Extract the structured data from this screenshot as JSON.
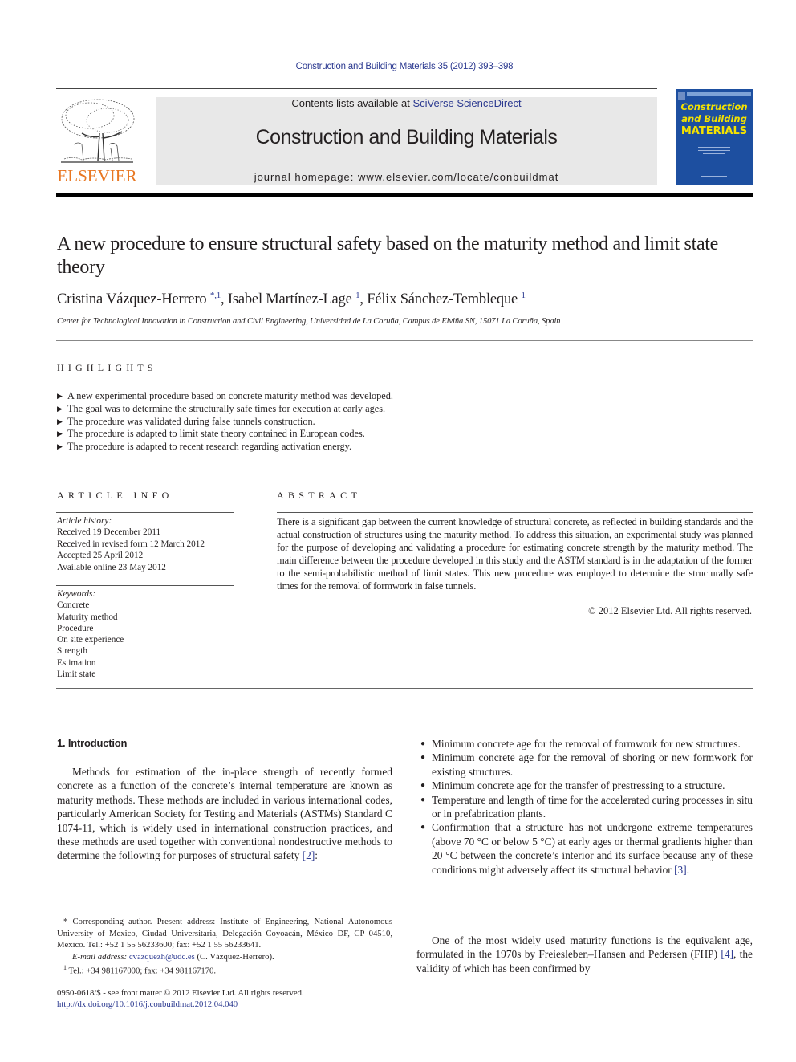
{
  "journal_ref": "Construction and Building Materials 35 (2012) 393–398",
  "header": {
    "publisher_logo_text": "ELSEVIER",
    "contents_prefix": "Contents lists available at ",
    "contents_link": "SciVerse ScienceDirect",
    "journal_title": "Construction and Building Materials",
    "homepage": "journal homepage: www.elsevier.com/locate/conbuildmat",
    "cover": {
      "line1": "Construction",
      "line2": "and Building",
      "line3": "MATERIALS",
      "bg_color": "#1d4fa0",
      "title_color": "#f4e200"
    }
  },
  "article": {
    "title": "A new procedure to ensure structural safety based on the maturity method and limit state theory",
    "authors": [
      {
        "name": "Cristina Vázquez-Herrero",
        "marks": "*,1"
      },
      {
        "name": "Isabel Martínez-Lage",
        "marks": "1"
      },
      {
        "name": "Félix Sánchez-Tembleque",
        "marks": "1"
      }
    ],
    "affiliation": "Center for Technological Innovation in Construction and Civil Engineering, Universidad de La Coruña, Campus de Elviña SN, 15071 La Coruña, Spain"
  },
  "highlights": {
    "label": "HIGHLIGHTS",
    "items": [
      "A new experimental procedure based on concrete maturity method was developed.",
      "The goal was to determine the structurally safe times for execution at early ages.",
      "The procedure was validated during false tunnels construction.",
      "The procedure is adapted to limit state theory contained in European codes.",
      "The procedure is adapted to recent research regarding activation energy."
    ]
  },
  "article_info": {
    "label": "ARTICLE INFO",
    "history_label": "Article history:",
    "history": [
      "Received 19 December 2011",
      "Received in revised form 12 March 2012",
      "Accepted 25 April 2012",
      "Available online 23 May 2012"
    ],
    "keywords_label": "Keywords:",
    "keywords": [
      "Concrete",
      "Maturity method",
      "Procedure",
      "On site experience",
      "Strength",
      "Estimation",
      "Limit state"
    ]
  },
  "abstract": {
    "label": "ABSTRACT",
    "text": "There is a significant gap between the current knowledge of structural concrete, as reflected in building standards and the actual construction of structures using the maturity method. To address this situation, an experimental study was planned for the purpose of developing and validating a procedure for estimating concrete strength by the maturity method. The main difference between the procedure developed in this study and the ASTM standard is in the adaptation of the former to the semi-probabilistic method of limit states. This new procedure was employed to determine the structurally safe times for the removal of formwork in false tunnels.",
    "copyright": "© 2012 Elsevier Ltd. All rights reserved."
  },
  "introduction": {
    "heading": "1. Introduction",
    "p1_text": "Methods for estimation of the in-place strength of recently formed concrete as a function of the concrete’s internal temperature are known as maturity methods. These methods are included in various international codes, particularly American Society for Testing and Materials (ASTMs) Standard C 1074-11, which is widely used in international construction practices, and these methods are used together with conventional nondestructive methods to determine the following for purposes of structural safety ",
    "p1_ref": "[2]",
    "p1_end": ":",
    "bullets": [
      {
        "text": "Minimum concrete age for the removal of formwork for new structures.",
        "ref": ""
      },
      {
        "text": "Minimum concrete age for the removal of shoring or new formwork for existing structures.",
        "ref": ""
      },
      {
        "text": "Minimum concrete age for the transfer of prestressing to a structure.",
        "ref": ""
      },
      {
        "text": "Temperature and length of time for the accelerated curing processes in situ or in prefabrication plants.",
        "ref": ""
      },
      {
        "text": "Confirmation that a structure has not undergone extreme temperatures (above 70 °C or below 5 °C) at early ages or thermal gradients higher than 20 °C between the concrete’s interior and its surface because any of these conditions might adversely affect its structural behavior ",
        "ref": "[3]",
        "end": "."
      }
    ],
    "p2_text": "One of the most widely used maturity functions is the equivalent age, formulated in the 1970s by Freiesleben–Hansen and Pedersen (FHP) ",
    "p2_ref": "[4]",
    "p2_end": ", the validity of which has been confirmed by"
  },
  "footnotes": {
    "corresponding": "* Corresponding author. Present address: Institute of Engineering, National Autonomous University of Mexico, Ciudad Universitaria, Delegación Coyoacán, México DF, CP 04510, Mexico. Tel.: +52 1 55 56233600; fax: +52 1 55 56233641.",
    "email_label": "E-mail address: ",
    "email": "cvazquezh@udc.es",
    "email_suffix": " (C. Vázquez-Herrero).",
    "fn1_mark": "1",
    "fn1": " Tel.: +34 981167000; fax: +34 981167170."
  },
  "bottom": {
    "issn": "0950-0618/$ - see front matter © 2012 Elsevier Ltd. All rights reserved.",
    "doi": "http://dx.doi.org/10.1016/j.conbuildmat.2012.04.040"
  },
  "colors": {
    "link": "#2b3990",
    "elsevier_orange": "#e87722",
    "header_box": "#e8e8e8"
  }
}
